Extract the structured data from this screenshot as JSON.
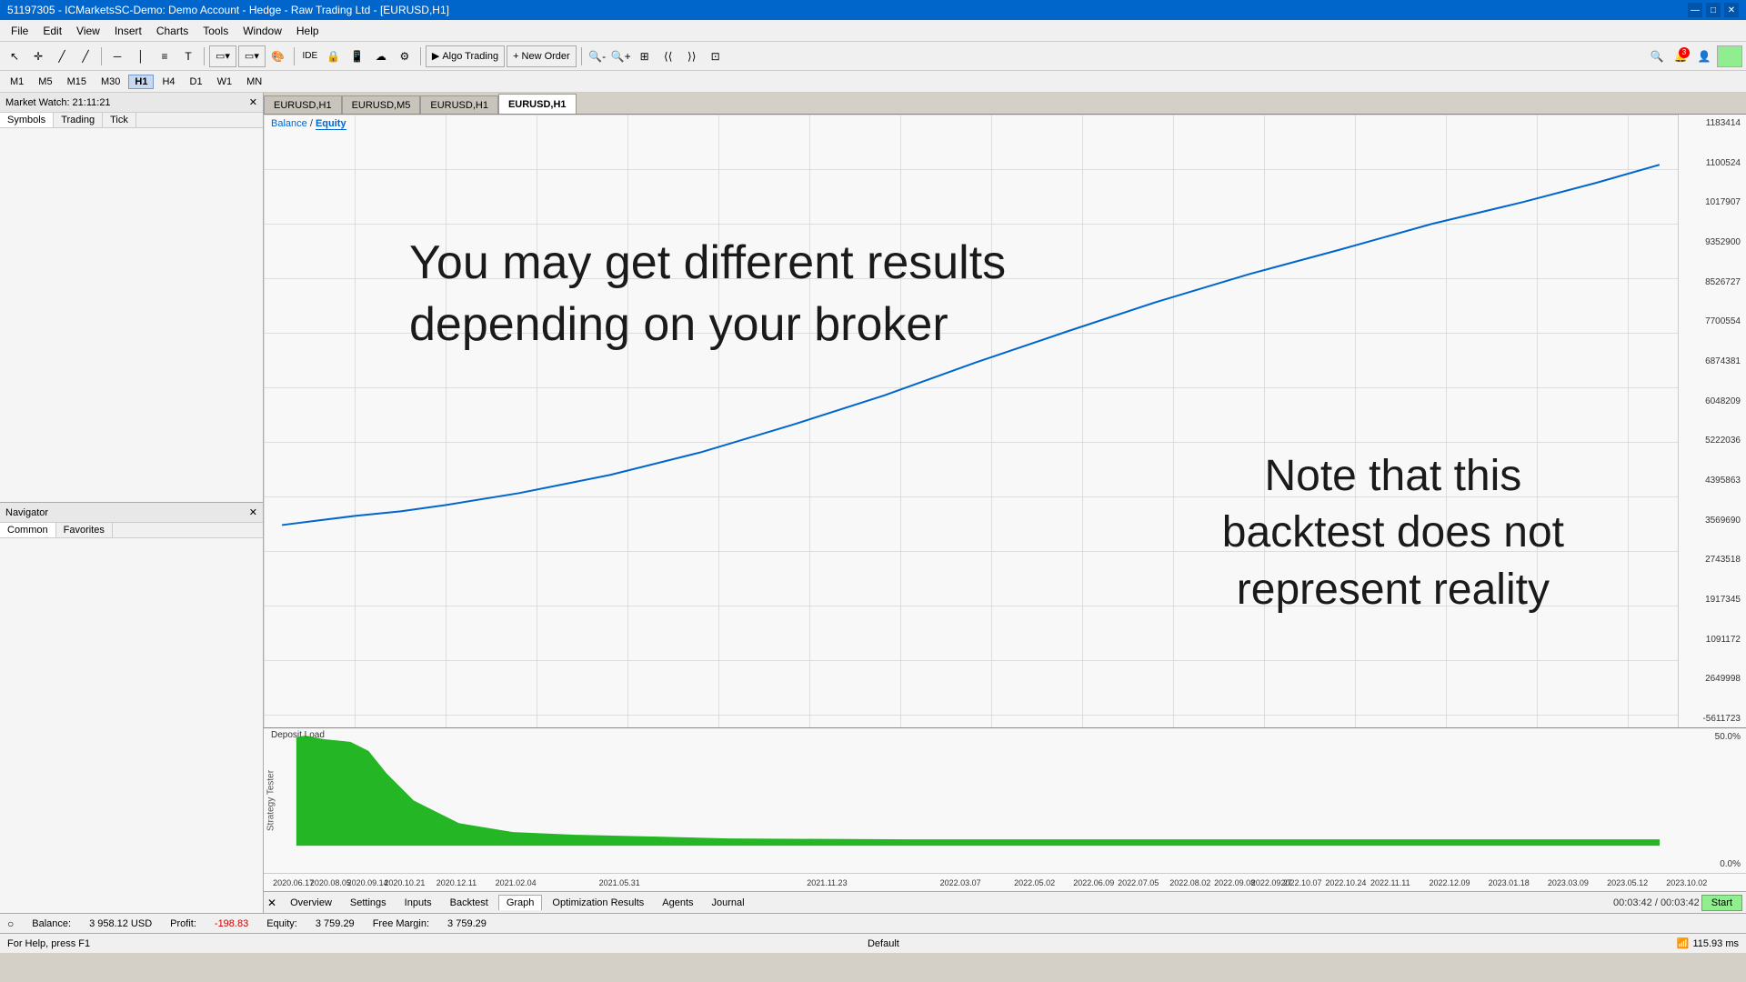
{
  "titlebar": {
    "title": "51197305 - ICMarketsSC-Demo: Demo Account - Hedge - Raw Trading Ltd - [EURUSD,H1]",
    "controls": [
      "—",
      "□",
      "✕"
    ]
  },
  "menubar": {
    "items": [
      "File",
      "Edit",
      "View",
      "Insert",
      "Charts",
      "Tools",
      "Window",
      "Help"
    ]
  },
  "toolbar": {
    "algo_trading": "Algo Trading",
    "new_order": "New Order"
  },
  "timeframes": {
    "items": [
      "M1",
      "M5",
      "M15",
      "M30",
      "H1",
      "H4",
      "D1",
      "W1",
      "MN"
    ],
    "active": "H1"
  },
  "panels": {
    "market_watch": {
      "title": "Market Watch: 21:11:21",
      "tabs": [
        "Symbols",
        "Trading",
        "Tick"
      ]
    },
    "navigator": {
      "title": "Navigator",
      "tabs": [
        "Common",
        "Favorites"
      ]
    }
  },
  "chart_tabs": {
    "items": [
      "EURUSD,H1",
      "EURUSD,M5",
      "EURUSD,H1",
      "EURUSD,H1"
    ],
    "active": 3
  },
  "main_chart": {
    "label": "Balance / Equity",
    "balance_link": "Balance",
    "equity_link": "Equity",
    "big_text_line1": "You may get different results",
    "big_text_line2": "depending on your broker",
    "note_line1": "Note that this",
    "note_line2": "backtest does not",
    "note_line3": "represent reality",
    "y_axis": [
      "1183414",
      "1100524",
      "1017907",
      "9352900",
      "8526727",
      "7700554",
      "6874381",
      "6048209",
      "5222036",
      "4395863",
      "3569690",
      "2743518",
      "1917345",
      "1091172",
      "2649998",
      "-5611723"
    ]
  },
  "sub_chart": {
    "label": "Deposit Load",
    "y_axis": [
      "50.0%",
      "0.0%"
    ]
  },
  "x_axis": {
    "ticks": [
      "2020.06.17",
      "2020.08.05",
      "2020.09.14",
      "2020.10.21",
      "2020.12.11",
      "2021.02.04",
      "2021.05.31",
      "2021.11.23",
      "2022.03.07",
      "2022.05.02",
      "2022.06.09",
      "2022.07.05",
      "2022.08.02",
      "2022.09.08",
      "2022.09.27",
      "2022.10.07",
      "2022.10.24",
      "2022.11.11",
      "2022.12.09",
      "2023.01.18",
      "2023.03.09",
      "2023.05.12",
      "2023.10.02"
    ]
  },
  "strategy_tester": {
    "tabs": [
      "Overview",
      "Settings",
      "Inputs",
      "Backtest",
      "Graph",
      "Optimization Results",
      "Agents",
      "Journal"
    ],
    "active": "Graph",
    "time": "00:03:42 / 00:03:42",
    "start_btn": "Start",
    "vertical_label": "Strategy Tester"
  },
  "status_bar": {
    "balance_label": "Balance:",
    "balance_value": "3 958.12 USD",
    "profit_label": "Profit:",
    "profit_value": "-198.83",
    "equity_label": "Equity:",
    "equity_value": "3 759.29",
    "free_margin_label": "Free Margin:",
    "free_margin_value": "3 759.29"
  },
  "bottom_bar": {
    "help": "For Help, press F1",
    "default": "Default",
    "signal": "115.93 ms"
  }
}
